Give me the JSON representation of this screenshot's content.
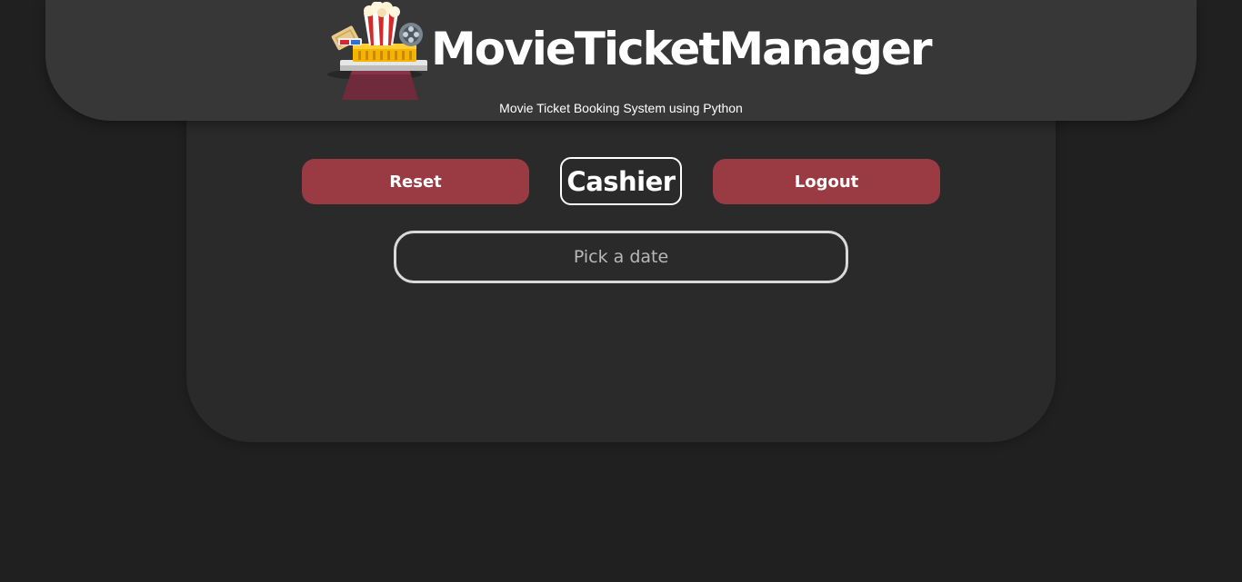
{
  "header": {
    "title": "MovieTicketManager",
    "subtitle": "Movie Ticket Booking System using Python",
    "logo_icon": "cinema-logo-icon"
  },
  "actions": {
    "reset_label": "Reset",
    "role_label": "Cashier",
    "logout_label": "Logout"
  },
  "date_picker": {
    "placeholder": "Pick a date",
    "value": ""
  },
  "colors": {
    "background": "#202020",
    "panel": "#2a2a2a",
    "header": "#373737",
    "accent": "#9a3b44",
    "text": "#ffffff"
  }
}
